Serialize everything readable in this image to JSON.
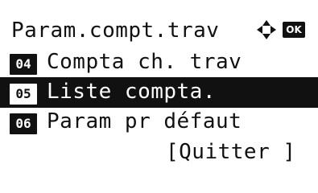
{
  "header": {
    "title": "Param.compt.trav",
    "nav_icon": "four-way-arrows-icon",
    "ok_label": "OK"
  },
  "menu": {
    "items": [
      {
        "number": "04",
        "label": "Compta ch. trav",
        "selected": false
      },
      {
        "number": "05",
        "label": "Liste compta.",
        "selected": true
      },
      {
        "number": "06",
        "label": "Param pr défaut",
        "selected": false
      }
    ]
  },
  "footer": {
    "quit_label": "[Quitter ]"
  },
  "colors": {
    "foreground": "#111111",
    "background": "#ffffff",
    "highlight": "#111111"
  }
}
